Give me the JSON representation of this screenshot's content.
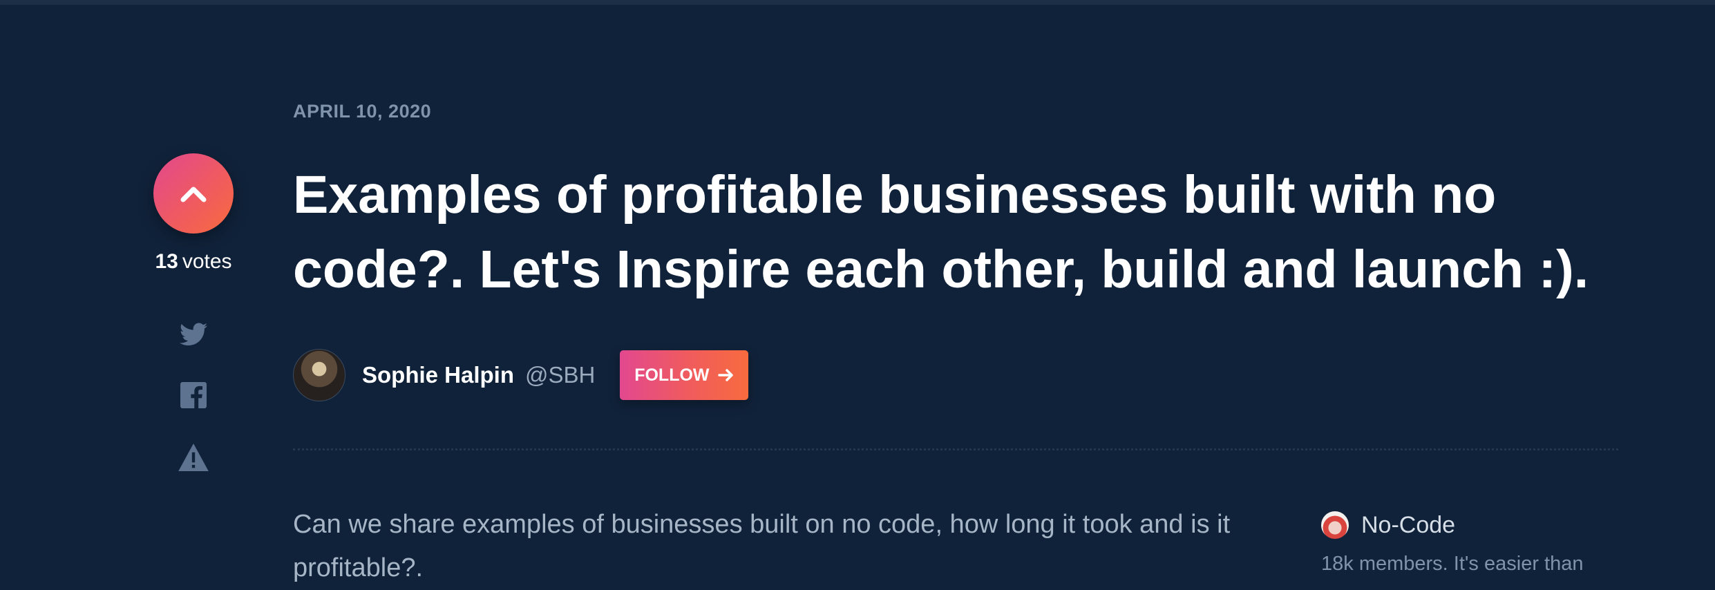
{
  "post": {
    "date": "APRIL 10, 2020",
    "title": "Examples of profitable businesses built with no code?. Let's Inspire each other, build and launch :).",
    "body": "Can we share examples of businesses built on no code, how long it took and is it profitable?."
  },
  "votes": {
    "count": "13",
    "label": "votes"
  },
  "author": {
    "name": "Sophie Halpin",
    "handle": "@SBH",
    "follow_label": "FOLLOW"
  },
  "share_icons": [
    "twitter-icon",
    "facebook-icon",
    "report-icon"
  ],
  "community": {
    "name": "No-Code",
    "description": "18k members. It's easier than"
  },
  "colors": {
    "background": "#10223a",
    "accent_start": "#e2488f",
    "accent_end": "#f76b3e",
    "muted": "#7f93aa"
  }
}
